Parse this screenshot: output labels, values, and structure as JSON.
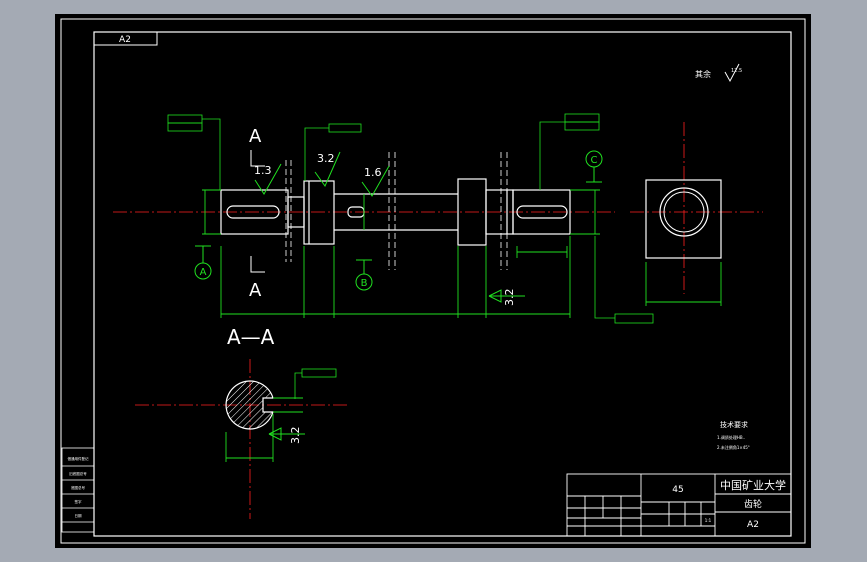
{
  "sheet": {
    "format_tag": "A2",
    "roughness_note_label": "其余",
    "roughness_note_value": "12.5"
  },
  "views": {
    "section_label_top": "A",
    "section_label_bottom": "A",
    "section_title": "A—A",
    "datum_a": "A",
    "datum_b": "B",
    "datum_c": "C",
    "roughness_1": "1.3",
    "roughness_2": "3.2",
    "roughness_3": "1.6",
    "roughness_4": "3.2",
    "roughness_section": "3.2"
  },
  "tech": {
    "title": "技术要求",
    "line1": "1.调质处理HB..",
    "line2": "2.未注倒角1×45°"
  },
  "title_block": {
    "material": "45",
    "school": "中国矿业大学",
    "part_name": "齿轮",
    "size": "A2",
    "scale_value": "1:1"
  },
  "side_stamp": {
    "row1": "借通用件登记",
    "row2": "旧底图总号",
    "row3": "底图总号",
    "row4": "签字",
    "row5": "日期"
  }
}
